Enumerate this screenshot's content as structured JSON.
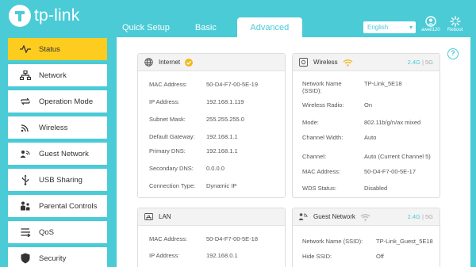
{
  "brand": {
    "name": "tp-link",
    "accent": "#4acbd6",
    "highlight": "#fccc1f"
  },
  "tabs": [
    {
      "label": "Quick Setup"
    },
    {
      "label": "Basic"
    },
    {
      "label": "Advanced",
      "active": true
    }
  ],
  "header": {
    "language": "English",
    "user_label": "aweil120",
    "reboot_label": "Reboot"
  },
  "sidebar": {
    "items": [
      {
        "label": "Status",
        "icon": "pulse-icon",
        "active": true
      },
      {
        "label": "Network",
        "icon": "network-icon"
      },
      {
        "label": "Operation Mode",
        "icon": "mode-switch-icon"
      },
      {
        "label": "Wireless",
        "icon": "wifi-icon"
      },
      {
        "label": "Guest Network",
        "icon": "guest-network-icon"
      },
      {
        "label": "USB Sharing",
        "icon": "usb-icon"
      },
      {
        "label": "Parental Controls",
        "icon": "parental-controls-icon"
      },
      {
        "label": "QoS",
        "icon": "qos-icon"
      },
      {
        "label": "Security",
        "icon": "shield-icon"
      }
    ]
  },
  "help_label": "?",
  "internet": {
    "title": "Internet",
    "rows": [
      {
        "key": "MAC Address:",
        "value": "50-D4-F7-00-5E-19"
      },
      {
        "key": "IP Address:",
        "value": "192.168.1.119"
      },
      {
        "key": "Subnet Mask:",
        "value": "255.255.255.0"
      },
      {
        "key": "Default Gateway:",
        "value": "192.168.1.1"
      },
      {
        "key": "Primary DNS:",
        "value": "192.168.1.1"
      },
      {
        "key": "Secondary DNS:",
        "value": "0.0.0.0"
      },
      {
        "key": "Connection Type:",
        "value": "Dynamic IP"
      }
    ]
  },
  "wireless": {
    "title": "Wireless",
    "band_24": "2.4G",
    "band_sep": "|",
    "band_5": "5G",
    "rows": [
      {
        "key": "Network Name (SSID):",
        "value": "TP-Link_5E18"
      },
      {
        "key": "Wireless Radio:",
        "value": "On"
      },
      {
        "key": "Mode:",
        "value": "802.11b/g/n/ax mixed"
      },
      {
        "key": "Channel Width:",
        "value": "Auto"
      },
      {
        "key": "Channel:",
        "value": "Auto (Current Channel 5)"
      },
      {
        "key": "MAC Address:",
        "value": "50-D4-F7-00-5E-17"
      },
      {
        "key": "WDS Status:",
        "value": "Disabled"
      }
    ]
  },
  "lan": {
    "title": "LAN",
    "rows": [
      {
        "key": "MAC Address:",
        "value": "50-D4-F7-00-5E-18"
      },
      {
        "key": "IP Address:",
        "value": "192.168.0.1"
      }
    ]
  },
  "guest": {
    "title": "Guest Network",
    "band_24": "2.4G",
    "band_sep": "|",
    "band_5": "5G",
    "rows": [
      {
        "key": "Network Name (SSID):",
        "value": "TP-Link_Guest_5E18"
      },
      {
        "key": "Hide SSID:",
        "value": "Off"
      }
    ]
  }
}
